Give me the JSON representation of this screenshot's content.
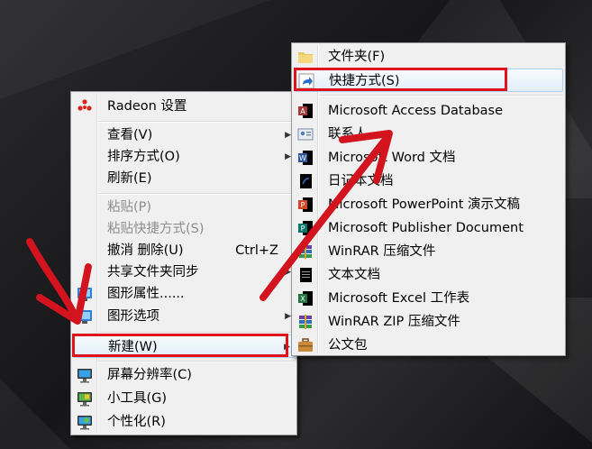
{
  "colors": {
    "annotation_red": "#e0131d",
    "menu_bg": "#f0f0f0",
    "disabled_text": "#8d8d8d"
  },
  "context_menu": {
    "items": [
      {
        "label": "Radeon 设置",
        "icon": "radeon-icon"
      },
      {
        "label": "查看(V)",
        "submenu": true
      },
      {
        "label": "排序方式(O)",
        "submenu": true
      },
      {
        "label": "刷新(E)"
      },
      {
        "label": "粘贴(P)",
        "disabled": true
      },
      {
        "label": "粘贴快捷方式(S)",
        "disabled": true
      },
      {
        "label": "撤消 删除(U)",
        "shortcut": "Ctrl+Z"
      },
      {
        "label": "共享文件夹同步",
        "submenu": true
      },
      {
        "label": "图形属性......",
        "icon": "graphics-properties-icon"
      },
      {
        "label": "图形选项",
        "icon": "graphics-options-icon",
        "submenu": true
      },
      {
        "label": "新建(W)",
        "submenu": true
      },
      {
        "label": "屏幕分辨率(C)",
        "icon": "screen-resolution-icon"
      },
      {
        "label": "小工具(G)",
        "icon": "gadgets-icon"
      },
      {
        "label": "个性化(R)",
        "icon": "personalize-icon"
      }
    ]
  },
  "new_submenu": {
    "items": [
      {
        "label": "文件夹(F)",
        "icon": "folder-icon"
      },
      {
        "label": "快捷方式(S)",
        "icon": "shortcut-icon"
      },
      {
        "label": "Microsoft Access Database",
        "icon": "access-icon"
      },
      {
        "label": "联系人",
        "icon": "contact-icon"
      },
      {
        "label": "Microsoft Word 文档",
        "icon": "word-icon"
      },
      {
        "label": "日记本文档",
        "icon": "journal-icon"
      },
      {
        "label": "Microsoft PowerPoint 演示文稿",
        "icon": "powerpoint-icon"
      },
      {
        "label": "Microsoft Publisher Document",
        "icon": "publisher-icon"
      },
      {
        "label": "WinRAR 压缩文件",
        "icon": "winrar-icon"
      },
      {
        "label": "文本文档",
        "icon": "text-document-icon"
      },
      {
        "label": "Microsoft Excel 工作表",
        "icon": "excel-icon"
      },
      {
        "label": "WinRAR ZIP 压缩文件",
        "icon": "winrar-zip-icon"
      },
      {
        "label": "公文包",
        "icon": "briefcase-icon"
      }
    ]
  }
}
